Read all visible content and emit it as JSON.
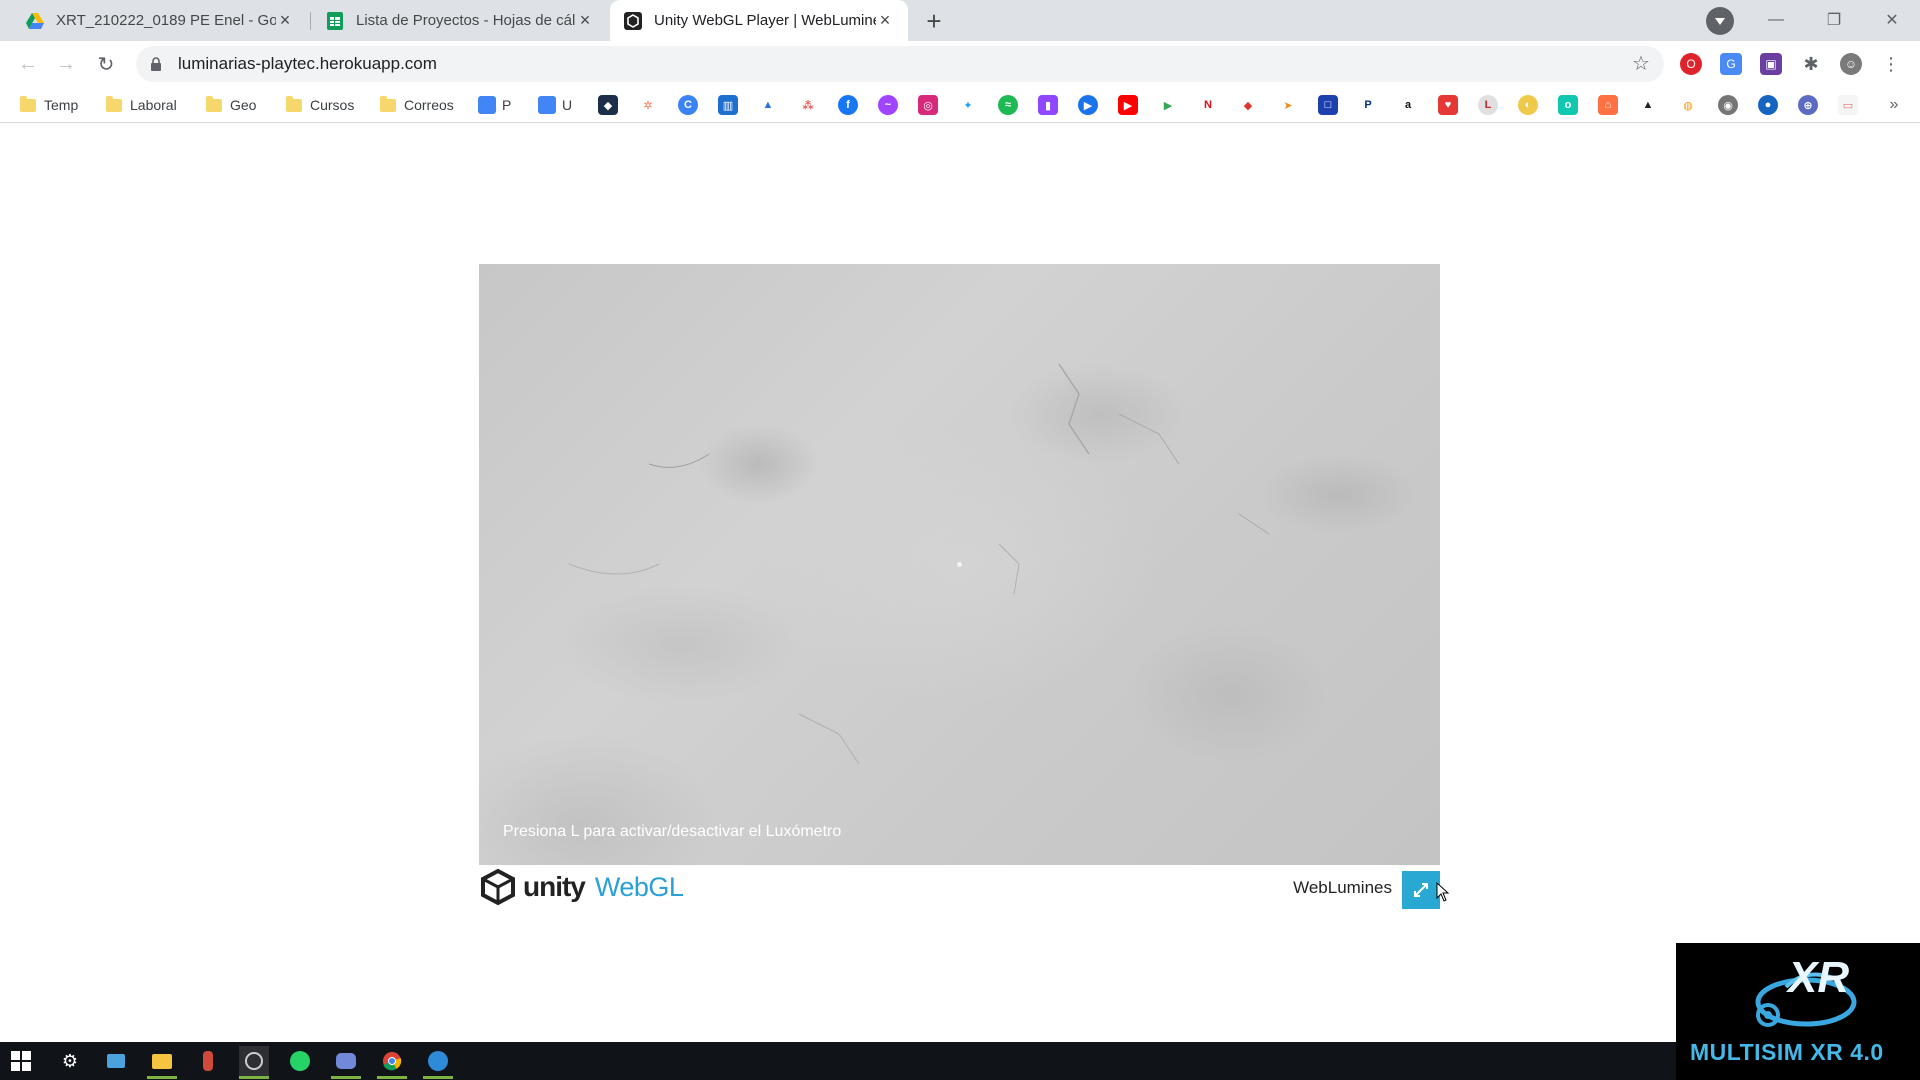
{
  "browser": {
    "tabs": [
      {
        "title": "XRT_210222_0189 PE Enel - Goo",
        "icon": "google-drive-icon",
        "active": false
      },
      {
        "title": "Lista de Proyectos - Hojas de cál",
        "icon": "google-sheets-icon",
        "active": false
      },
      {
        "title": "Unity WebGL Player | WebLumine",
        "icon": "unity-icon",
        "active": true
      }
    ],
    "url": "luminarias-playtec.herokuapp.com",
    "bookmarks": [
      {
        "label": "Temp",
        "icon": "folder-icon"
      },
      {
        "label": "Laboral",
        "icon": "folder-icon"
      },
      {
        "label": "Geo",
        "icon": "folder-icon"
      },
      {
        "label": "Cursos",
        "icon": "folder-icon"
      },
      {
        "label": "Correos",
        "icon": "folder-icon"
      },
      {
        "label": "P",
        "icon": "calendar-icon"
      },
      {
        "label": "U",
        "icon": "calendar-icon"
      }
    ],
    "colors": {
      "tab_strip": "#dee1e6",
      "omnibox": "#f1f3f4",
      "accent": "#2aa8d4"
    }
  },
  "page": {
    "canvas_hint": "Presiona L para activar/desactivar el Luxómetro",
    "unity_logo_word": "unity",
    "unity_logo_suffix": "WebGL",
    "build_title": "WebLumines"
  },
  "overlay": {
    "logo_text": "MULTISIM XR 4.0",
    "logo_mark": "XR"
  }
}
